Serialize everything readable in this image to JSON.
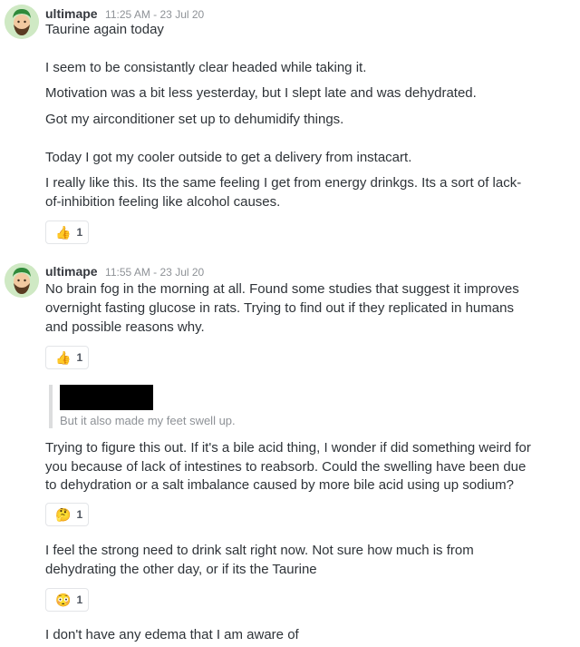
{
  "messages": [
    {
      "author": "ultimape",
      "timestamp": "11:25 AM - 23 Jul 20",
      "lines": [
        "Taurine again today",
        "I seem to be consistantly clear headed while taking it.",
        "Motivation was a bit less yesterday, but I slept late and was dehydrated.",
        "Got my airconditioner set up to dehumidify things.",
        "Today I got my cooler outside to get a delivery from instacart.",
        "I really like this. Its the same feeling I get from energy drinkgs. Its a sort of lack-",
        "of-inhibition feeling like alcohol causes."
      ],
      "reaction": {
        "icon": "thumbs-up-icon",
        "emoji": "👍",
        "count": "1"
      }
    },
    {
      "author": "ultimape",
      "timestamp": "11:55 AM - 23 Jul 20",
      "lines": [
        "No brain fog in the morning at all. Found some studies that suggest it improves",
        "overnight fasting glucose in rats. Trying to find out if they replicated in humans",
        "and possible reasons why."
      ],
      "reaction": {
        "icon": "thumbs-up-icon",
        "emoji": "👍",
        "count": "1"
      },
      "quote": {
        "text": "But it also made my feet swell up."
      },
      "followups": [
        {
          "lines": [
            "Trying to figure this out. If it's a bile acid thing, I wonder if did something weird for",
            "you because of lack of intestines to reabsorb. Could the swelling have been due",
            "to dehydration or a salt imbalance caused by more bile acid using up sodium?"
          ],
          "reaction": {
            "icon": "thinking-face-icon",
            "emoji": "🤔",
            "count": "1"
          }
        },
        {
          "lines": [
            "I feel the strong need to drink salt right now. Not sure how much is from",
            "dehydrating the other day, or if its the Taurine"
          ],
          "reaction": {
            "icon": "flushed-face-icon",
            "emoji": "😳",
            "count": "1"
          }
        },
        {
          "lines": [
            "I don't have any edema that I am aware of"
          ]
        }
      ]
    }
  ],
  "colors": {
    "author": "#36393f",
    "timestamp": "#8e9297",
    "text": "#2e3338",
    "quote_bar": "#dcddde",
    "reaction_border": "#e3e5e8"
  }
}
